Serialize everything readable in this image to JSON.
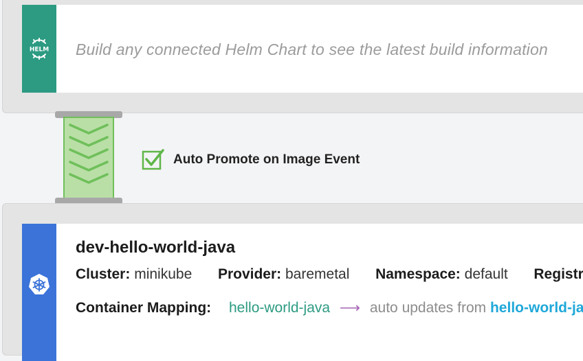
{
  "helm_stage": {
    "badge_text": "HELM",
    "placeholder": "Build any connected Helm Chart to see the latest build information",
    "strip_color": "#2c9b82"
  },
  "promotion": {
    "checked": true,
    "label": "Auto Promote on Image Event",
    "connector_color": "#b9dfa6"
  },
  "environment": {
    "name": "dev-hello-world-java",
    "strip_color": "#3b73d9",
    "icon": "kubernetes-icon",
    "cluster_label": "Cluster:",
    "cluster_value": "minikube",
    "provider_label": "Provider:",
    "provider_value": "baremetal",
    "namespace_label": "Namespace:",
    "namespace_value": "default",
    "registry_label": "Registry:",
    "mapping_label": "Container Mapping:",
    "mapping_image": "hello-world-java",
    "mapping_arrow": "⟶",
    "mapping_text": "auto updates from",
    "mapping_source": "hello-world-java"
  }
}
